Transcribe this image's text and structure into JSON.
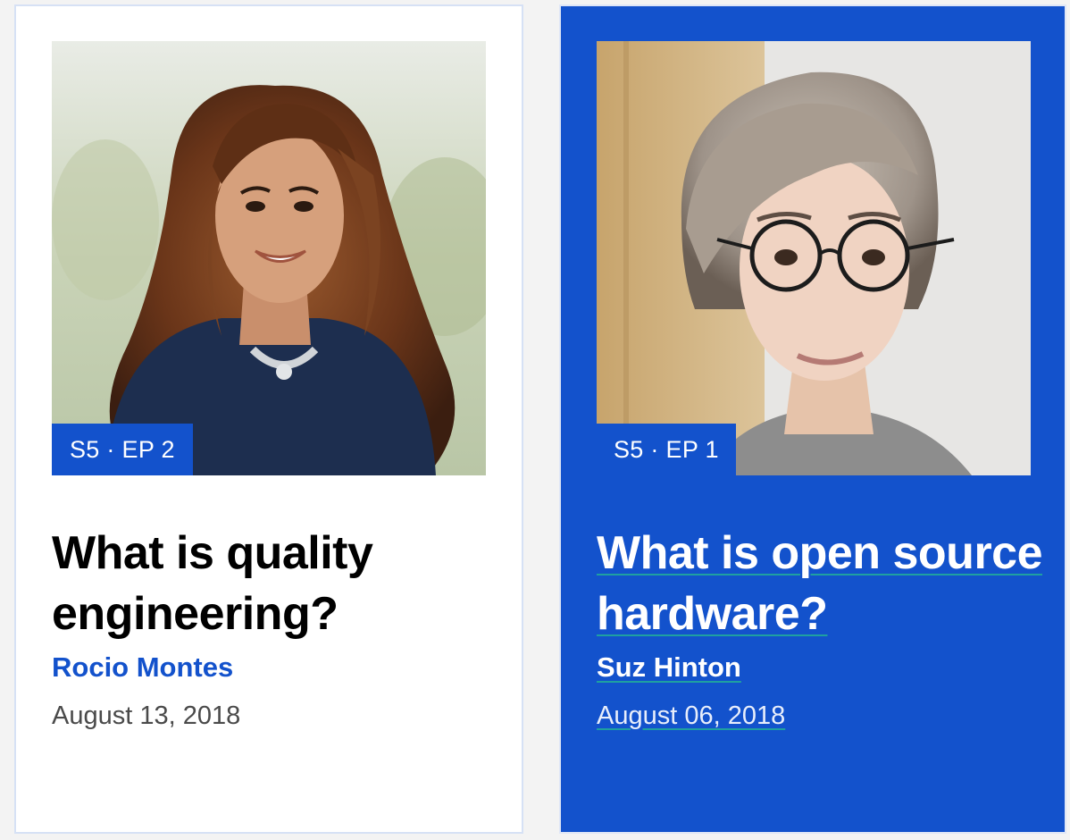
{
  "episodes": [
    {
      "badge": "S5 · EP 2",
      "title": "What is quality engineering?",
      "author": "Rocio Montes",
      "date": "August 13, 2018",
      "photo_icon": "portrait-photo"
    },
    {
      "badge": "S5 · EP 1",
      "title": "What is open source hardware?",
      "author": "Suz Hinton",
      "date": "August 06, 2018",
      "photo_icon": "portrait-photo"
    }
  ],
  "colors": {
    "accent_blue": "#1352cc",
    "card_light_bg": "#ffffff",
    "link_underline": "#1fa0a0",
    "title_dark": "#000000",
    "date_gray": "#4a4a4a"
  }
}
